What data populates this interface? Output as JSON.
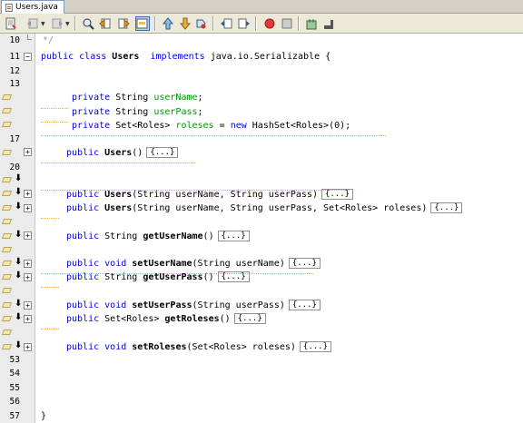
{
  "tab": {
    "title": "Users.java"
  },
  "toolbar": {
    "buttons": [
      "back",
      "forward",
      "find",
      "find-previous",
      "find-next",
      "toggle-highlight",
      "previous-bookmark",
      "next-bookmark",
      "toggle-bookmark",
      "shift-left",
      "shift-right",
      "start-macro",
      "stop-macro",
      "check-syntax",
      "comment"
    ]
  },
  "fold_label": "{...}",
  "gutter": {
    "line_numbers": [
      "10",
      "11",
      "12",
      "13",
      "17",
      "20",
      "53",
      "54",
      "55",
      "56",
      "57"
    ]
  },
  "code": {
    "comment_close": "*/",
    "class_public": "public",
    "class_kw": "class",
    "class_name": "Users",
    "class_implements": "implements",
    "class_iface": "java.io.Serializable",
    "class_brace": "{",
    "f1_mod": "private",
    "f1_type": "String",
    "f1_name": "userName",
    "f1_end": ";",
    "f2_mod": "private",
    "f2_type": "String",
    "f2_name": "userPass",
    "f2_end": ";",
    "f3_mod": "private",
    "f3_type": "Set<Roles>",
    "f3_name": "roleses",
    "f3_eq": "=",
    "f3_new": "new",
    "f3_rest": "HashSet<Roles>(0);",
    "m1_mod": "public",
    "m1_name": "Users",
    "m1_args": "()",
    "m2_mod": "public",
    "m2_name": "Users",
    "m2_args": "(String userName, String userPass)",
    "m3_mod": "public",
    "m3_name": "Users",
    "m3_args": "(String userName, String userPass, Set<Roles> roleses)",
    "m4_mod": "public",
    "m4_type": "String",
    "m4_name": "getUserName",
    "m4_args": "()",
    "m5_mod": "public",
    "m5_type": "void",
    "m5_name": "setUserName",
    "m5_args": "(String userName)",
    "m6_mod": "public",
    "m6_type": "String",
    "m6_name": "getUserPass",
    "m6_args": "()",
    "m7_mod": "public",
    "m7_type": "void",
    "m7_name": "setUserPass",
    "m7_args": "(String userPass)",
    "m8_mod": "public",
    "m8_type": "Set<Roles>",
    "m8_name": "getRoleses",
    "m8_args": "()",
    "m9_mod": "public",
    "m9_type": "void",
    "m9_name": "setRoleses",
    "m9_args": "(Set<Roles> roleses)",
    "class_close": "}"
  }
}
